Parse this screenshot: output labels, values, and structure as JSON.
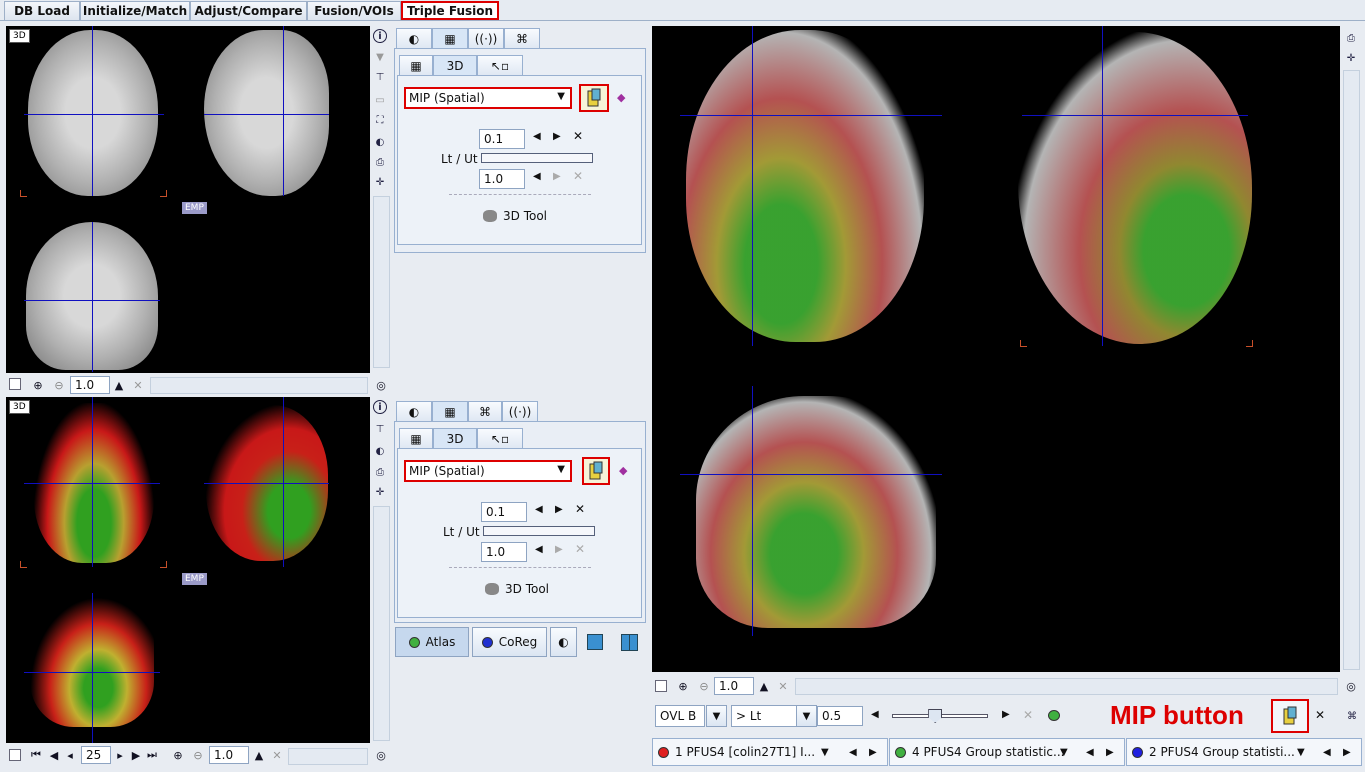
{
  "tabs": [
    "DB Load",
    "Initialize/Match",
    "Adjust/Compare",
    "Fusion/VOIs",
    "Triple Fusion"
  ],
  "viewers": {
    "top_left": {
      "badge": "3D",
      "emp_label": "EMP",
      "zoom": "1.0"
    },
    "bottom_left": {
      "badge": "3D",
      "emp_label": "EMP",
      "zoom": "1.0",
      "slice": "25"
    }
  },
  "panel_top": {
    "subtabs": [
      "3D"
    ],
    "mode": "MIP (Spatial)",
    "lower": "0.1",
    "range_label": "Lt / Ut",
    "upper": "1.0",
    "tool_label": "3D Tool"
  },
  "panel_bottom": {
    "subtabs": [
      "3D"
    ],
    "mode": "MIP (Spatial)",
    "lower": "0.1",
    "range_label": "Lt / Ut",
    "upper": "1.0",
    "tool_label": "3D Tool"
  },
  "buttons": {
    "atlas": "Atlas",
    "coreg": "CoReg"
  },
  "main_viewer": {
    "zoom": "1.0"
  },
  "bottom_controls": {
    "overlay_mode": "OVL B",
    "threshold_mode": "> Lt",
    "threshold_value": "0.5",
    "slider_level": 0.45,
    "mip_annotation": "MIP button"
  },
  "status_items": [
    {
      "label": "1 PFUS4 [colin27T1] I...",
      "color": "#e02020"
    },
    {
      "label": "4 PFUS4 Group statistic...",
      "color": "#40b040"
    },
    {
      "label": "2 PFUS4 Group statisti...",
      "color": "#2020e0"
    }
  ],
  "icons": [
    "info-icon",
    "print-icon",
    "crosshair-icon",
    "contrast-icon",
    "grid-icon",
    "cursor-icon",
    "mip-icon",
    "close-icon",
    "zoom-in-icon",
    "zoom-out-icon"
  ],
  "colors": {
    "accent_red": "#dd0000",
    "crosshair": "#1010c0",
    "corner": "#c8502a"
  }
}
